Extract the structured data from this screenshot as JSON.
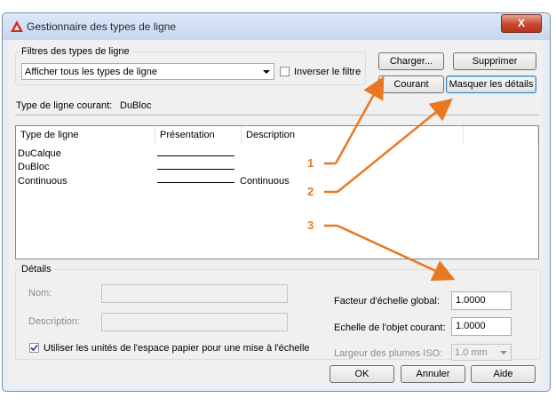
{
  "window": {
    "title": "Gestionnaire des types de ligne",
    "close_glyph": "X"
  },
  "filters": {
    "group_label": "Filtres des types de ligne",
    "selected": "Afficher tous les types de ligne",
    "invert_label": "Inverser le filtre",
    "invert_checked": false
  },
  "buttons": {
    "load": "Charger...",
    "delete": "Supprimer",
    "current": "Courant",
    "hide_details": "Masquer les détails",
    "ok": "OK",
    "cancel": "Annuler",
    "help": "Aide"
  },
  "current_linetype": {
    "label": "Type de ligne courant:",
    "value": "DuBloc"
  },
  "list": {
    "columns": [
      "Type de ligne",
      "Présentation",
      "Description"
    ],
    "rows": [
      {
        "name": "DuCalque",
        "description": ""
      },
      {
        "name": "DuBloc",
        "description": ""
      },
      {
        "name": "Continuous",
        "description": "Continuous"
      }
    ]
  },
  "details": {
    "group_label": "Détails",
    "name_label": "Nom:",
    "description_label": "Description:",
    "paper_units_label": "Utiliser les unités de l'espace papier pour une mise à l'échelle",
    "paper_units_checked": true,
    "global_scale_label": "Facteur d'échelle global:",
    "global_scale_value": "1.0000",
    "object_scale_label": "Echelle de l'objet courant:",
    "object_scale_value": "1.0000",
    "pen_width_label": "Largeur des plumes ISO:",
    "pen_width_value": "1.0 mm"
  },
  "annotations": [
    "1",
    "2",
    "3"
  ],
  "colors": {
    "annotation": "#e87722",
    "title_icon": "#d42a1f",
    "close_button": "#c8472e"
  }
}
